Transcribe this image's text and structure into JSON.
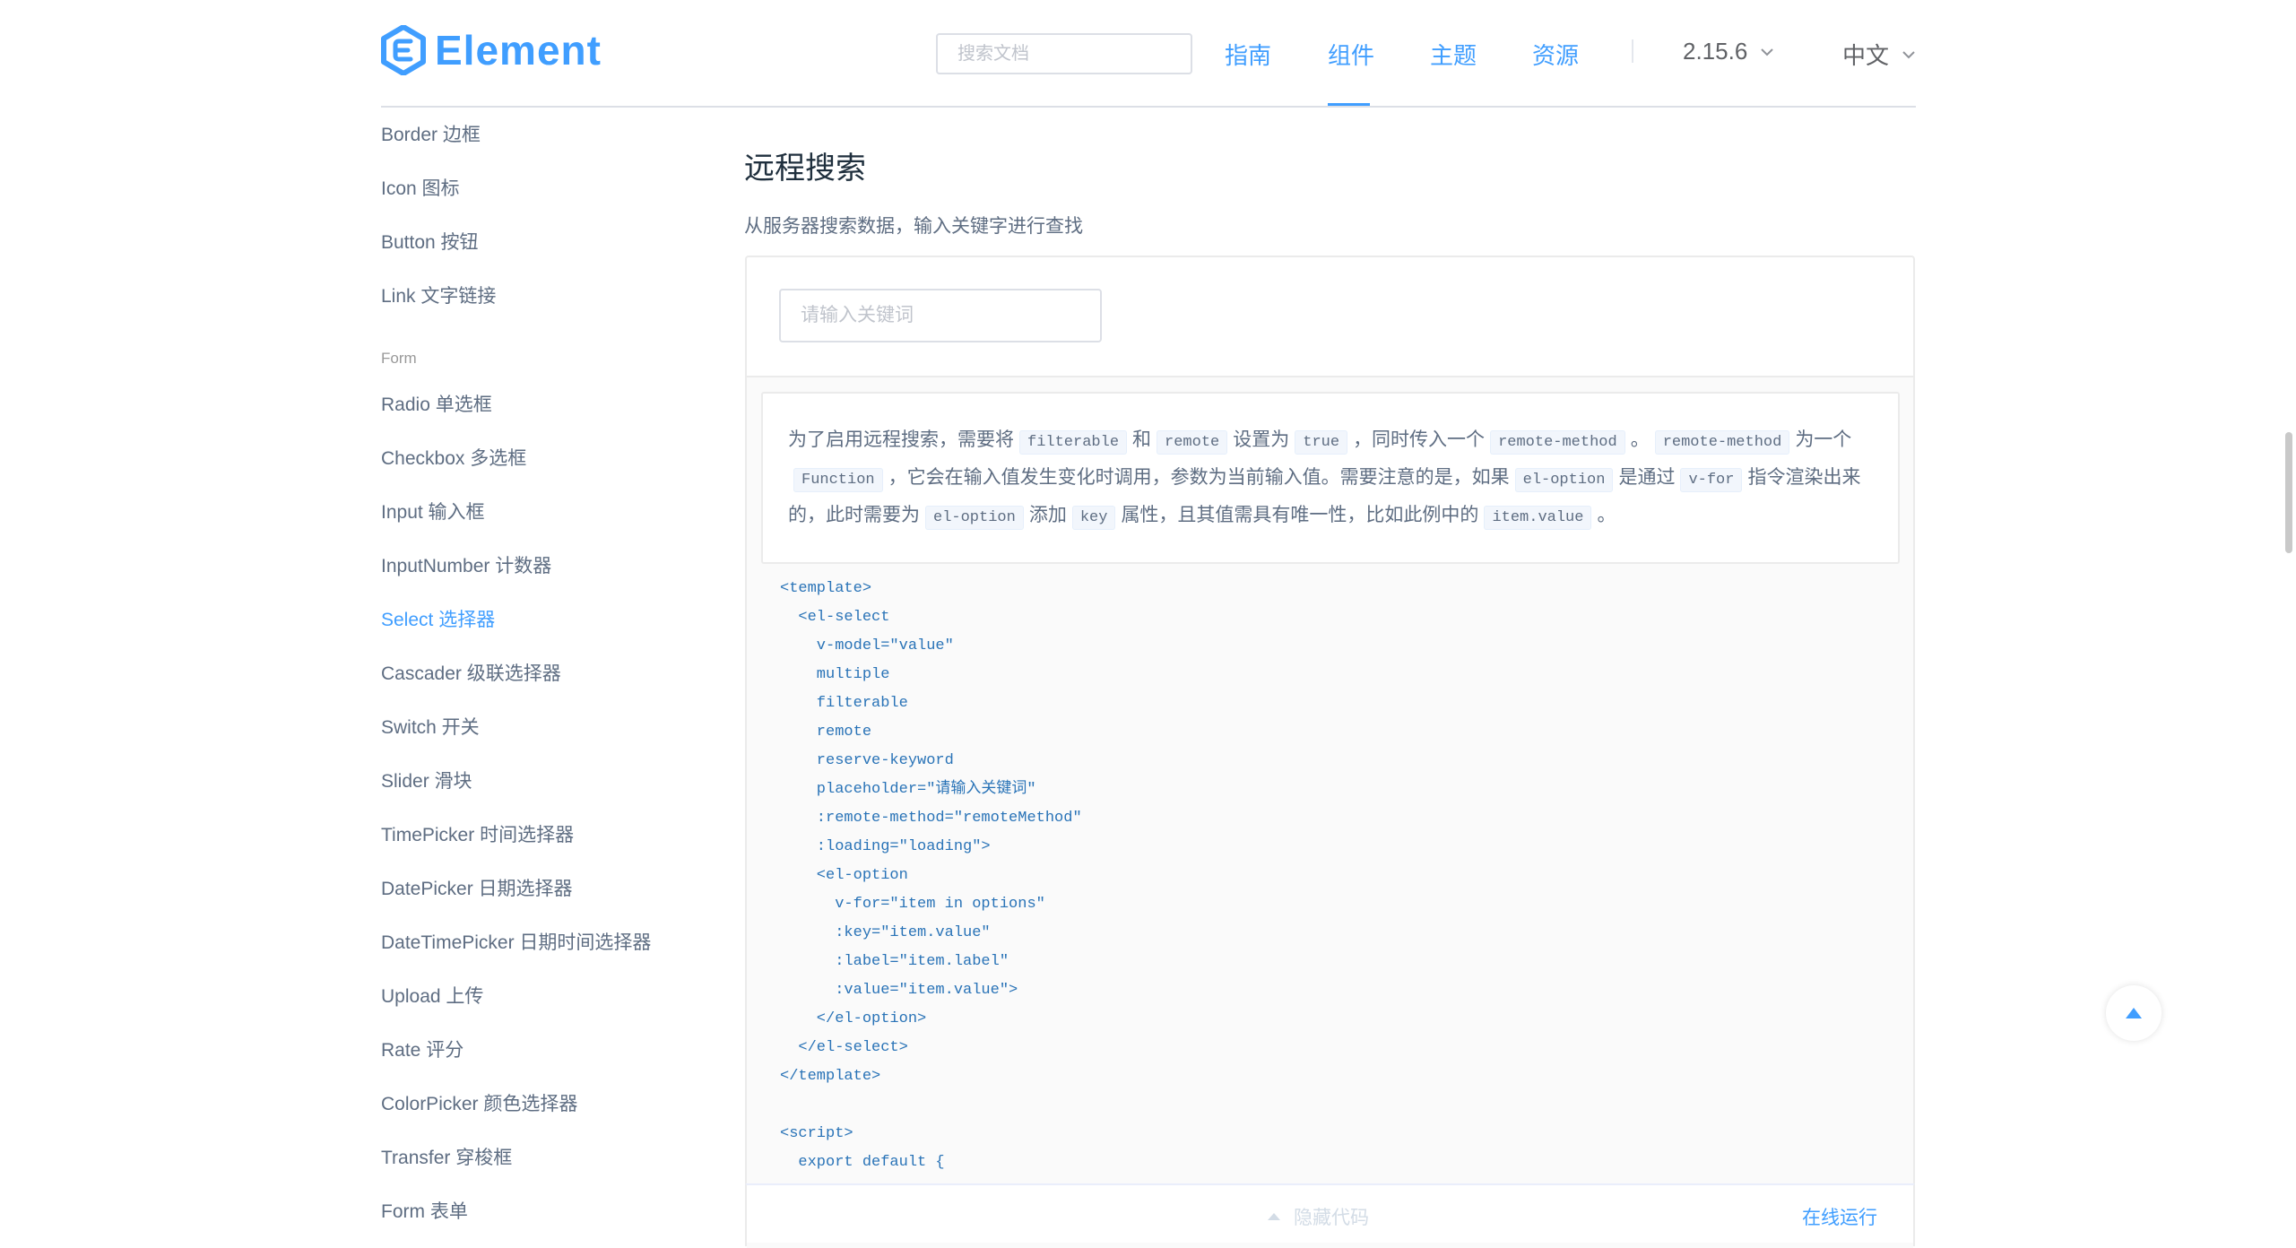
{
  "header": {
    "logo_text": "Element",
    "search_placeholder": "搜索文档",
    "nav": [
      "指南",
      "组件",
      "主题",
      "资源"
    ],
    "active_nav": "组件",
    "version": "2.15.6",
    "language": "中文"
  },
  "sidebar": {
    "items_top": [
      "Border 边框",
      "Icon 图标",
      "Button 按钮",
      "Link 文字链接"
    ],
    "group_label": "Form",
    "items_form": [
      "Radio 单选框",
      "Checkbox 多选框",
      "Input 输入框",
      "InputNumber 计数器",
      "Select 选择器",
      "Cascader 级联选择器",
      "Switch 开关",
      "Slider 滑块",
      "TimePicker 时间选择器",
      "DatePicker 日期选择器",
      "DateTimePicker 日期时间选择器",
      "Upload 上传",
      "Rate 评分",
      "ColorPicker 颜色选择器",
      "Transfer 穿梭框",
      "Form 表单"
    ],
    "active_item": "Select 选择器"
  },
  "main": {
    "title": "远程搜索",
    "description": "从服务器搜索数据，输入关键字进行查找",
    "demo_input_placeholder": "请输入关键词",
    "desc": {
      "p1": "为了启用远程搜索，需要将",
      "c1": "filterable",
      "p2": "和",
      "c2": "remote",
      "p3": "设置为",
      "c3": "true",
      "p4": "，同时传入一个",
      "c4": "remote-method",
      "p5": "。",
      "c5": "remote-method",
      "p6": "为一个",
      "c6": "Function",
      "p7": "，它会在输入值发生变化时调用，参数为当前输入值。需要注意的是，如果",
      "c7": "el-option",
      "p8": "是通过",
      "c8": "v-for",
      "p9": "指令渲染出来的，此时需要为",
      "c9": "el-option",
      "p10": "添加",
      "c10": "key",
      "p11": "属性，且其值需具有唯一性，比如此例中的",
      "c11": "item.value",
      "p12": "。"
    },
    "code_lines": [
      "<template>",
      "  <el-select",
      "    v-model=\"value\"",
      "    multiple",
      "    filterable",
      "    remote",
      "    reserve-keyword",
      "    placeholder=\"请输入关键词\"",
      "    :remote-method=\"remoteMethod\"",
      "    :loading=\"loading\">",
      "    <el-option",
      "      v-for=\"item in options\"",
      "      :key=\"item.value\"",
      "      :label=\"item.label\"",
      "      :value=\"item.value\">",
      "    </el-option>",
      "  </el-select>",
      "</template>",
      "",
      "<script>",
      "  export default {"
    ],
    "hide_code_label": "隐藏代码",
    "run_online_label": "在线运行"
  },
  "colors": {
    "primary": "#409EFF",
    "sidebar_text": "#5e6d82",
    "border": "#dcdfe6"
  },
  "icons": [
    "element-logo-icon",
    "chevron-down-icon",
    "caret-up-icon",
    "back-to-top-icon"
  ]
}
